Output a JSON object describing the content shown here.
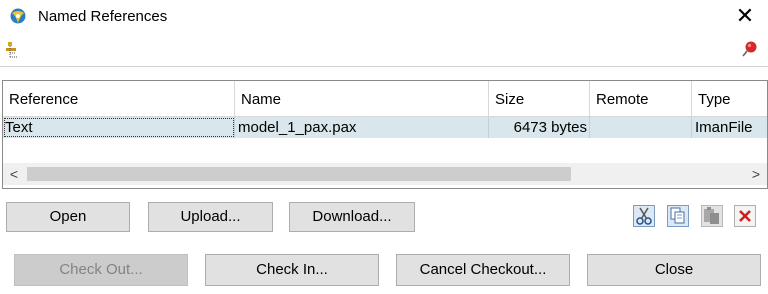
{
  "window": {
    "title": "Named References",
    "close_symbol": "✕"
  },
  "icons": {
    "app": "app-logo-icon",
    "toolbar_left": "tree-expand-icon",
    "toolbar_right": "pushpin-icon",
    "cut": "cut-icon",
    "copy": "copy-icon",
    "paste": "paste-icon",
    "delete": "delete-icon"
  },
  "table": {
    "columns": [
      "Reference",
      "Name",
      "Size",
      "Remote",
      "Type"
    ],
    "rows": [
      {
        "reference": "Text",
        "name": "model_1_pax.pax",
        "size": "6473 bytes",
        "remote": "",
        "type": "ImanFile"
      }
    ],
    "scroll_left": "<",
    "scroll_right": ">"
  },
  "buttons": {
    "open": "Open",
    "upload": "Upload...",
    "download": "Download...",
    "check_out": "Check Out...",
    "check_in": "Check In...",
    "cancel_checkout": "Cancel Checkout...",
    "close": "Close"
  },
  "colors": {
    "selected_row": "#d9e6ec",
    "delete_red": "#cc1f1f",
    "pin_red": "#d42a2a"
  }
}
